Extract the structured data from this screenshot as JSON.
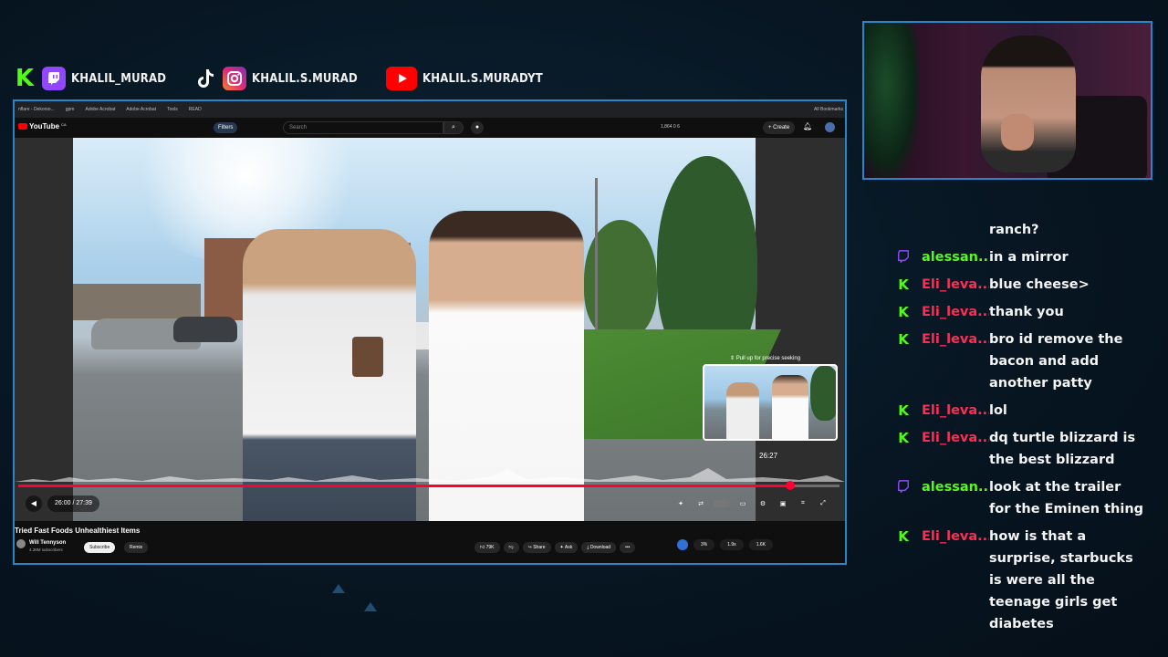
{
  "socials": [
    {
      "platform": "kick",
      "icon": "kick-icon",
      "handle": "",
      "color": "#53fc18"
    },
    {
      "platform": "twitch",
      "icon": "twitch-icon",
      "handle": "KHALIL_MURAD",
      "color": "#9146ff"
    },
    {
      "platform": "tiktok",
      "icon": "tiktok-icon",
      "handle": "",
      "color": "#000000"
    },
    {
      "platform": "instagram",
      "icon": "instagram-icon",
      "handle": "KHALIL.S.MURAD",
      "color": "#e1306c"
    },
    {
      "platform": "youtube",
      "icon": "youtube-icon",
      "handle": "KHALIL.S.MURADYT",
      "color": "#ff0000"
    }
  ],
  "browser": {
    "bookmarks": [
      "nflare - Dekorso...",
      "gpm",
      "Adobe Acrobat",
      "Adobe Acrobat",
      "Tools",
      "READ"
    ],
    "all_bookmarks": "All Bookmarks"
  },
  "youtube": {
    "logo": "YouTube",
    "country": "CA",
    "filters": "Filters",
    "search_placeholder": "Search",
    "header_stats": "1,864  0  6",
    "create": "+ Create",
    "seek_hint": "⇕ Pull up for precise seeking",
    "preview_time": "26:27",
    "time_display": "26:00 / 27:39",
    "progress_fraction": 0.94,
    "video_title": "Tried Fast Foods Unhealthiest Items",
    "channel_name": "Will Tennyson",
    "channel_subs": "4.38M subscribers",
    "subscribe": "Subscribe",
    "remix": "Remix",
    "actions": {
      "like": "79K",
      "share": "Share",
      "ask": "Ask",
      "download": "Download",
      "more": "•••"
    },
    "stat_pills": [
      "3%",
      "1.9x",
      "1.6K"
    ]
  },
  "chat": [
    {
      "platform": "",
      "user": "",
      "user_color": "#ffffff",
      "text": "ranch?"
    },
    {
      "platform": "twitch",
      "user": "alessan...",
      "user_color": "#53fc18",
      "text": "in a mirror"
    },
    {
      "platform": "kick",
      "user": "Eli_leva...",
      "user_color": "#ff2d55",
      "text": "blue cheese>"
    },
    {
      "platform": "kick",
      "user": "Eli_leva...",
      "user_color": "#ff2d55",
      "text": "thank you"
    },
    {
      "platform": "kick",
      "user": "Eli_leva...",
      "user_color": "#ff2d55",
      "text": "bro id remove the bacon and add another patty"
    },
    {
      "platform": "kick",
      "user": "Eli_leva...",
      "user_color": "#ff2d55",
      "text": "lol"
    },
    {
      "platform": "kick",
      "user": "Eli_leva...",
      "user_color": "#ff2d55",
      "text": "dq turtle blizzard is the best blizzard"
    },
    {
      "platform": "twitch",
      "user": "alessan...",
      "user_color": "#53fc18",
      "text": "look at the trailer for the Eminen thing"
    },
    {
      "platform": "kick",
      "user": "Eli_leva...",
      "user_color": "#ff2d55",
      "text": "how is that a surprise, starbucks is were all the teenage girls get diabetes"
    }
  ]
}
